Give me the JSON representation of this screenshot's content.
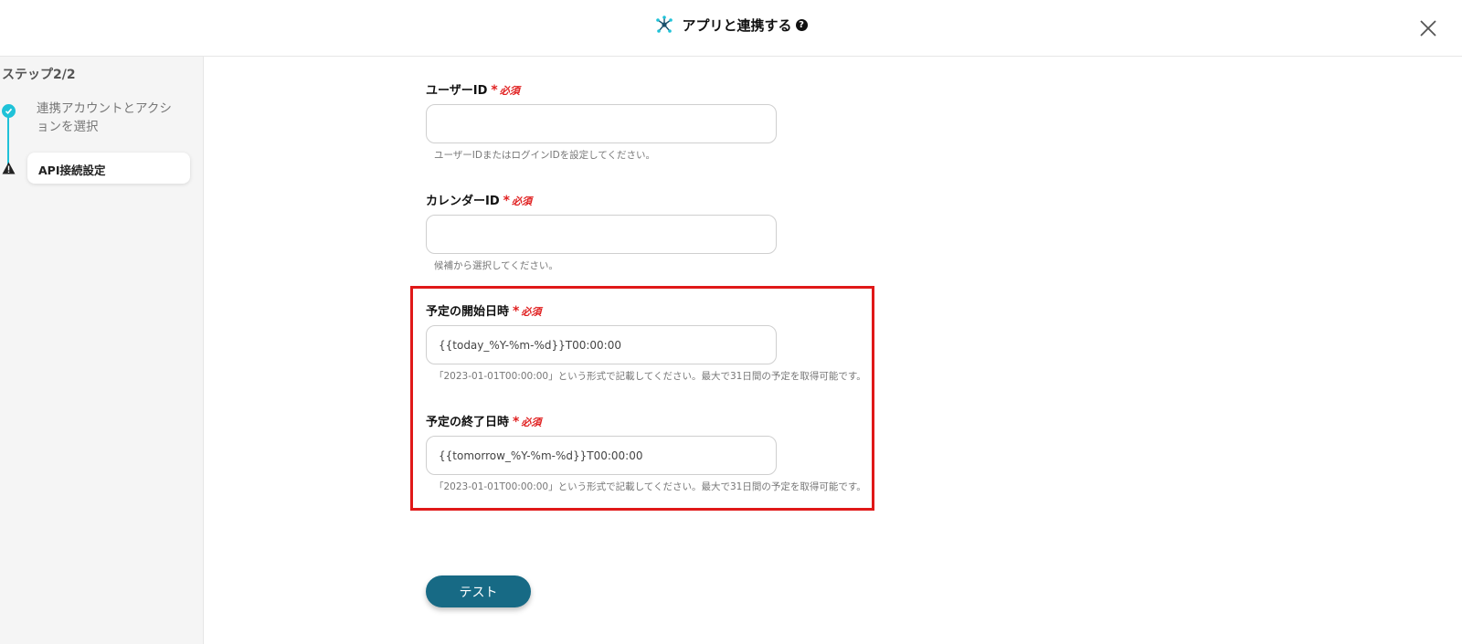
{
  "header": {
    "title": "アプリと連携する",
    "help_glyph": "?"
  },
  "sidebar": {
    "step_heading": "ステップ2/2",
    "steps": [
      {
        "label": "連携アカウントとアクションを選択",
        "status": "done"
      },
      {
        "label": "API接続設定",
        "status": "warning"
      }
    ]
  },
  "form": {
    "required_text": "必須",
    "required_star": "*",
    "fields": [
      {
        "label": "ユーザーID",
        "value": "",
        "help": "ユーザーIDまたはログインIDを設定してください。"
      },
      {
        "label": "カレンダーID",
        "value": "",
        "help": "候補から選択してください。"
      },
      {
        "label": "予定の開始日時",
        "value": "{{today_%Y-%m-%d}}T00:00:00",
        "help": "「2023-01-01T00:00:00」という形式で記載してください。最大で31日間の予定を取得可能です。"
      },
      {
        "label": "予定の終了日時",
        "value": "{{tomorrow_%Y-%m-%d}}T00:00:00",
        "help": "「2023-01-01T00:00:00」という形式で記載してください。最大で31日間の予定を取得可能です。"
      }
    ]
  },
  "actions": {
    "test_label": "テスト"
  },
  "colors": {
    "accent": "#1fc2d8",
    "required": "#e02020",
    "highlight": "#e01818",
    "button": "#176a85"
  },
  "icons": {
    "app": "network-nodes-icon",
    "help": "question-circle-icon",
    "close": "close-icon",
    "step_done": "check-circle-icon",
    "step_warning": "warning-triangle-icon"
  }
}
